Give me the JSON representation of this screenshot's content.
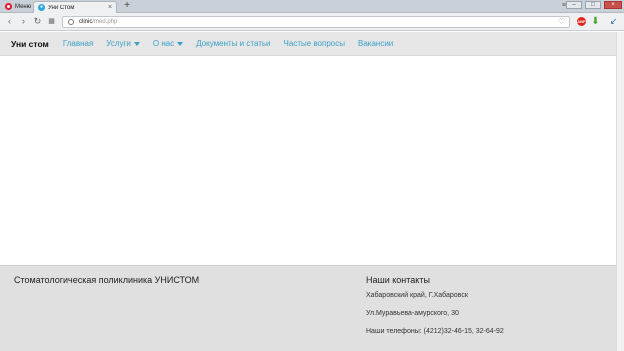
{
  "browser": {
    "menu_label": "Меню",
    "tab_title": "Уни Стом",
    "new_tab": "+",
    "url_host": "clinic",
    "url_path": "/med.php",
    "adblock_label": "ABP"
  },
  "nav": {
    "brand": "Уни стом",
    "links": [
      {
        "label": "Главная"
      },
      {
        "label": "Услуги"
      },
      {
        "label": "О нас"
      },
      {
        "label": "Документы и статьи"
      },
      {
        "label": "Частые вопросы"
      },
      {
        "label": "Вакансии"
      }
    ]
  },
  "footer": {
    "organization": "Стоматологическая поликлиника УНИСТОМ",
    "contacts_title": "Наши контакты",
    "address_region": "Хабаровский край, Г.Хабаровск",
    "address_street": "Ул.Муравьева-амурского, 30",
    "phones": "Наши телефоны: (4212)32-46-15, 32-64-92"
  }
}
